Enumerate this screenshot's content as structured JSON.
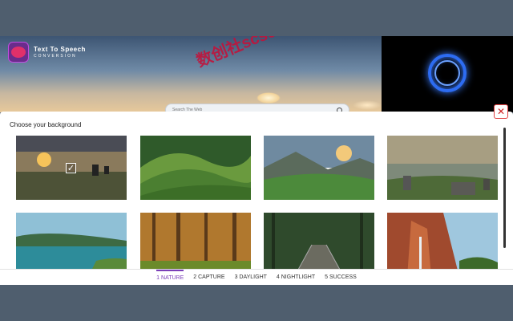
{
  "app": {
    "title": "Text To Speech",
    "subtitle": "CONVERSION"
  },
  "watermark": "数创社scs66",
  "search": {
    "placeholder": "Search The Web"
  },
  "panel": {
    "title": "Choose your background",
    "close_label": "✕"
  },
  "tiles": [
    {
      "name": "sunset-fields",
      "selected": true
    },
    {
      "name": "green-hills",
      "selected": false
    },
    {
      "name": "mountain-valley",
      "selected": false
    },
    {
      "name": "rocky-plateau",
      "selected": false
    },
    {
      "name": "lake-coast",
      "selected": false
    },
    {
      "name": "autumn-forest",
      "selected": false
    },
    {
      "name": "forest-bridge",
      "selected": false
    },
    {
      "name": "red-cliffs",
      "selected": false
    }
  ],
  "check_mark": "✓",
  "tabs": [
    {
      "label": "1 NATURE",
      "active": true
    },
    {
      "label": "2 CAPTURE",
      "active": false
    },
    {
      "label": "3 DAYLIGHT",
      "active": false
    },
    {
      "label": "4 NIGHTLIGHT",
      "active": false
    },
    {
      "label": "5 SUCCESS",
      "active": false
    }
  ],
  "colors": {
    "accent": "#7b3fb8",
    "close": "#d02020",
    "background": "#4f5e6e"
  }
}
